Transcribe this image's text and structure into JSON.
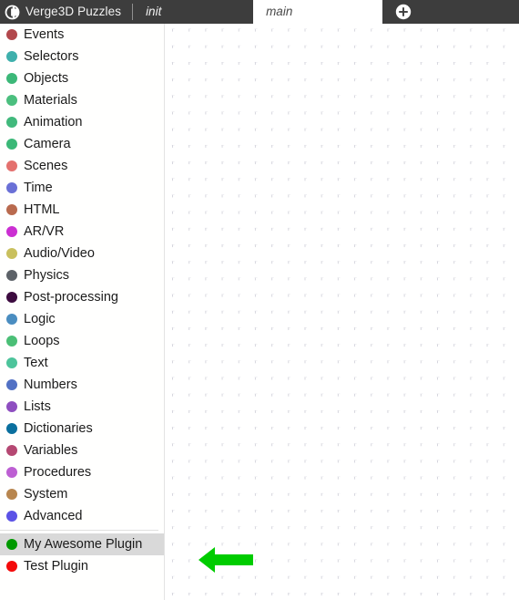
{
  "app": {
    "title": "Verge3D Puzzles",
    "logo_icon": "verge3d-puzzle-logo-icon",
    "header_bg": "#3d3d3d",
    "header_text_color": "#f2f2f2"
  },
  "tabs": {
    "items": [
      {
        "label": "init",
        "active": false
      },
      {
        "label": "main",
        "active": true
      }
    ],
    "add_tab_icon": "plus-circle-icon",
    "active_tab_bg": "#ffffff",
    "active_tab_text": "#4a4a4a"
  },
  "toolbox": {
    "categories": [
      {
        "label": "Events",
        "color": "#b2484c"
      },
      {
        "label": "Selectors",
        "color": "#3fb0ac"
      },
      {
        "label": "Objects",
        "color": "#3cb878"
      },
      {
        "label": "Materials",
        "color": "#4bbf7e"
      },
      {
        "label": "Animation",
        "color": "#41b97c"
      },
      {
        "label": "Camera",
        "color": "#3bb877"
      },
      {
        "label": "Scenes",
        "color": "#e4716e"
      },
      {
        "label": "Time",
        "color": "#6a70d6"
      },
      {
        "label": "HTML",
        "color": "#b96a4e"
      },
      {
        "label": "AR/VR",
        "color": "#cb2fd2"
      },
      {
        "label": "Audio/Video",
        "color": "#c9c05e"
      },
      {
        "label": "Physics",
        "color": "#5d6268"
      },
      {
        "label": "Post-processing",
        "color": "#3c0b3f"
      },
      {
        "label": "Logic",
        "color": "#4a8dc0"
      },
      {
        "label": "Loops",
        "color": "#4bbf76"
      },
      {
        "label": "Text",
        "color": "#4dc49b"
      },
      {
        "label": "Numbers",
        "color": "#5271c4"
      },
      {
        "label": "Lists",
        "color": "#8e4ec0"
      },
      {
        "label": "Dictionaries",
        "color": "#0a6f9e"
      },
      {
        "label": "Variables",
        "color": "#b54872"
      },
      {
        "label": "Procedures",
        "color": "#bd5fd3"
      },
      {
        "label": "System",
        "color": "#b8864f"
      },
      {
        "label": "Advanced",
        "color": "#5b52e6"
      }
    ],
    "plugins": [
      {
        "label": "My Awesome Plugin",
        "color": "#009900",
        "selected": true
      },
      {
        "label": "Test Plugin",
        "color": "#f40a0a",
        "selected": false
      }
    ]
  },
  "workspace": {
    "grid_dot_color": "#d6d6de",
    "background": "#ffffff",
    "annotation": {
      "type": "arrow-left",
      "color": "#00cc00"
    }
  }
}
